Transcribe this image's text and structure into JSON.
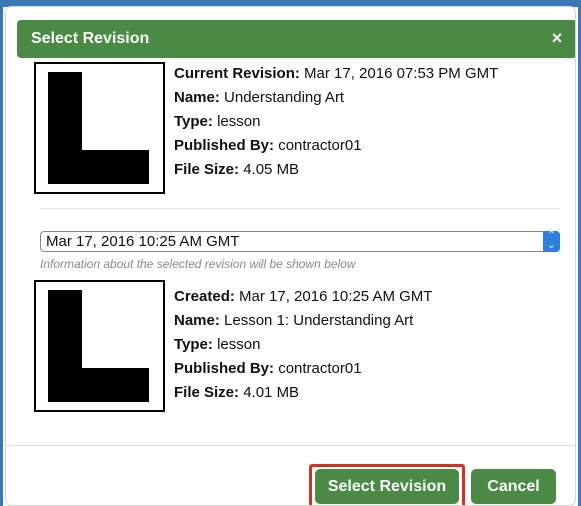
{
  "dialog": {
    "title": "Select Revision",
    "close_glyph": "×"
  },
  "current": {
    "label": "Current Revision:",
    "value": "Mar 17, 2016 07:53 PM GMT",
    "name_label": "Name:",
    "name": "Understanding Art",
    "type_label": "Type:",
    "type": "lesson",
    "published_label": "Published By:",
    "published_by": "contractor01",
    "size_label": "File Size:",
    "size": "4.05 MB"
  },
  "selector": {
    "selected": "Mar 17, 2016 10:25 AM GMT",
    "hint": "Information about the selected revision will be shown below"
  },
  "selected": {
    "label": "Created:",
    "value": "Mar 17, 2016 10:25 AM GMT",
    "name_label": "Name:",
    "name": "Lesson 1: Understanding Art",
    "type_label": "Type:",
    "type": "lesson",
    "published_label": "Published By:",
    "published_by": "contractor01",
    "size_label": "File Size:",
    "size": "4.01 MB"
  },
  "buttons": {
    "select_label": "Select Revision",
    "cancel_label": "Cancel"
  },
  "colors": {
    "header_green": "#4b8a44",
    "frame_blue": "#3a78b8",
    "highlight_red": "#d0321f"
  }
}
